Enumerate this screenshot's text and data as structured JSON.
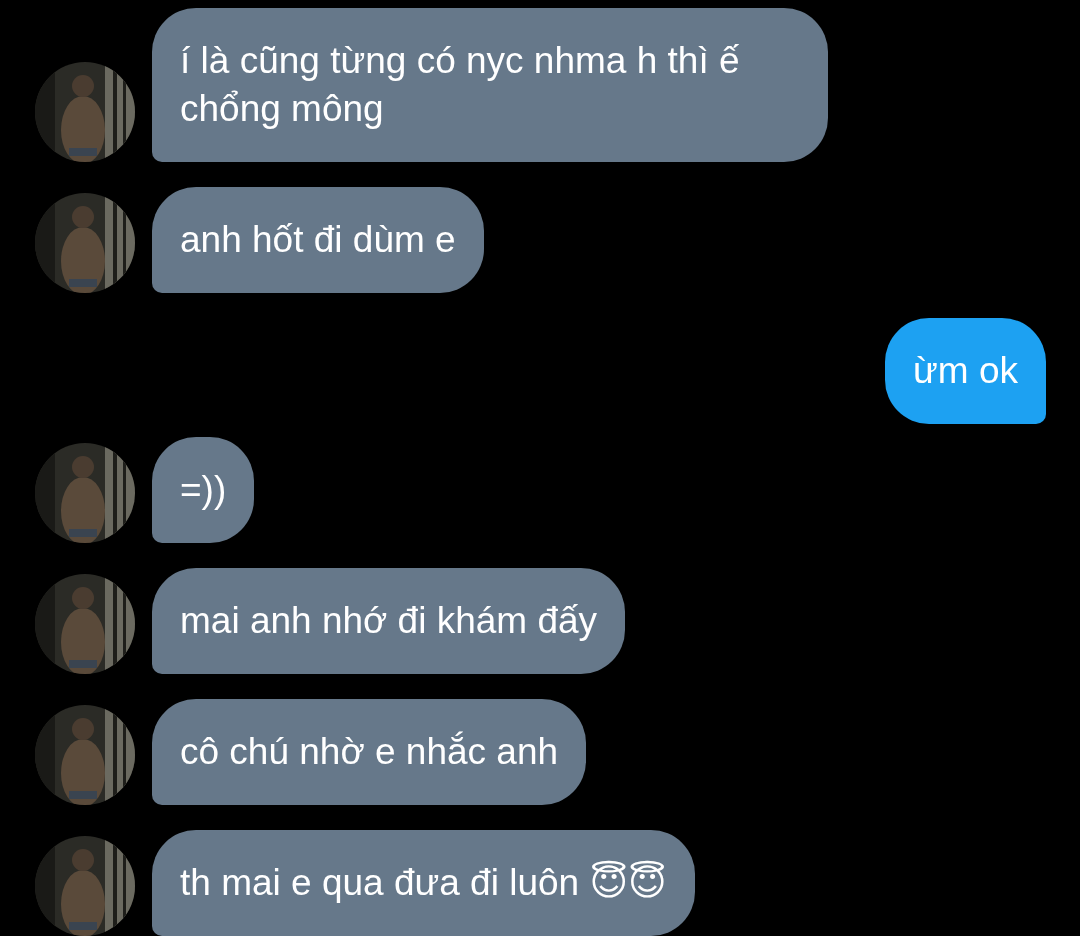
{
  "messages": [
    {
      "kind": "incoming",
      "text": "í là cũng từng có nyc nhma h thì ế chổng mông"
    },
    {
      "kind": "incoming",
      "text": "anh hốt đi dùm e"
    },
    {
      "kind": "outgoing",
      "text": "ừm ok"
    },
    {
      "kind": "incoming",
      "text": "=))"
    },
    {
      "kind": "incoming",
      "text": "mai anh nhớ đi khám đấy"
    },
    {
      "kind": "incoming",
      "text": "cô chú nhờ e nhắc anh"
    },
    {
      "kind": "incoming",
      "text": "th mai e qua đưa đi luôn 😇😇"
    }
  ]
}
